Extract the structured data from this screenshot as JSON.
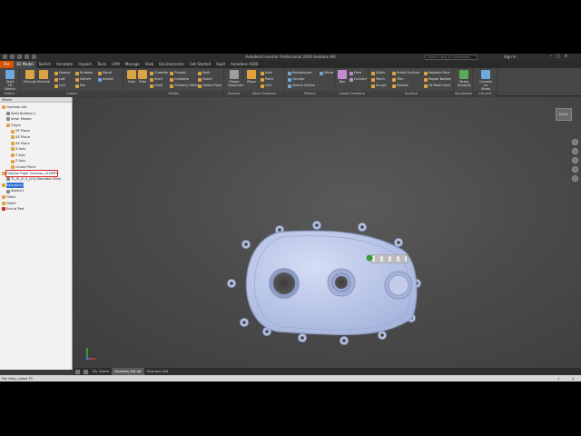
{
  "app_title": "Autodesk Inventor Professional 2019    Gearbox AIA",
  "search_placeholder": "Search Help & Commands...",
  "signin": "Sign In",
  "tabs": [
    "File",
    "3D Model",
    "Sketch",
    "Annotate",
    "Inspect",
    "Tools",
    "CAM",
    "Manage",
    "View",
    "Environments",
    "Get Started",
    "Vault",
    "Autodesk A360"
  ],
  "active_tab": "3D Model",
  "ribbon": {
    "sketch_panel": {
      "label": "Sketch",
      "start_sketch": "Start 2D Sketch"
    },
    "create_panel": {
      "label": "Create",
      "extrude": "Extrude",
      "revolve": "Revolve",
      "col1": [
        "Sweep",
        "Loft",
        "Coil"
      ],
      "col2": [
        "Emboss",
        "Derive",
        "Rib"
      ],
      "col3": [
        "Decal",
        "Import"
      ]
    },
    "modify_panel": {
      "label": "Modify",
      "hole": "Hole",
      "fillet": "Fillet",
      "col1": [
        "Chamfer",
        "Shell",
        "Draft"
      ],
      "col2": [
        "Thread",
        "Combine",
        "Thicken/ Offset"
      ],
      "col3": [
        "Split",
        "Direct",
        "Delete Face"
      ]
    },
    "explore_panel": {
      "label": "Explore",
      "shape_generator": "Shape Generator"
    },
    "work_panel": {
      "label": "Work Features",
      "plane": "Plane",
      "col1": [
        "Axis",
        "Point",
        "UCS"
      ]
    },
    "pattern_panel": {
      "label": "Pattern",
      "col1": [
        "Rectangular",
        "Circular",
        "Sketch Driven"
      ],
      "col2": [
        "Mirror"
      ]
    },
    "freeform_panel": {
      "label": "Create Freeform",
      "box": "Box",
      "col1": [
        "Face",
        "Convert"
      ]
    },
    "surface_panel": {
      "label": "Surface",
      "col1": [
        "Stitch",
        "Patch",
        "Sculpt"
      ],
      "col2": [
        "Ruled Surface",
        "Trim",
        "Extend"
      ],
      "col3": [
        "Replace Face",
        "Repair Bodies",
        "Fit Mesh Face"
      ]
    },
    "simulation_panel": {
      "label": "Simulation",
      "stress": "Stress Analysis"
    },
    "convert_panel": {
      "label": "Convert",
      "sheet_metal": "Convert to Sheet Metal"
    }
  },
  "browser": {
    "header": "Model",
    "nodes": [
      {
        "label": "Gearbox AIA",
        "indent": 0,
        "icon": "#e2a43a",
        "state": ""
      },
      {
        "label": "Solid Bodies(1)",
        "indent": 1,
        "icon": "#888888",
        "state": ""
      },
      {
        "label": "View: Master",
        "indent": 1,
        "icon": "#888888",
        "state": ""
      },
      {
        "label": "Origin",
        "indent": 1,
        "icon": "#e2a43a",
        "state": ""
      },
      {
        "label": "YZ Plane",
        "indent": 2,
        "icon": "#e2a43a",
        "state": ""
      },
      {
        "label": "XZ Plane",
        "indent": 2,
        "icon": "#e2a43a",
        "state": ""
      },
      {
        "label": "XY Plane",
        "indent": 2,
        "icon": "#e2a43a",
        "state": ""
      },
      {
        "label": "X Axis",
        "indent": 2,
        "icon": "#e2a43a",
        "state": ""
      },
      {
        "label": "Y Axis",
        "indent": 2,
        "icon": "#e2a43a",
        "state": ""
      },
      {
        "label": "Z Axis",
        "indent": 2,
        "icon": "#e2a43a",
        "state": ""
      },
      {
        "label": "Center Point",
        "indent": 2,
        "icon": "#e2a43a",
        "state": ""
      },
      {
        "label": "Original Right Gearbox_SLDPRT",
        "indent": 0,
        "icon": "#e2a43a",
        "state": "sel-red"
      },
      {
        "label": "TL_IS_D_S_(15) Diameter Slim)",
        "indent": 1,
        "icon": "#888888",
        "state": ""
      },
      {
        "label": "Extrusion1",
        "indent": 0,
        "icon": "#e2a43a",
        "state": "sel-blue"
      },
      {
        "label": "Sketch1",
        "indent": 1,
        "icon": "#888888",
        "state": ""
      },
      {
        "label": "Fillet1",
        "indent": 0,
        "icon": "#e2a43a",
        "state": ""
      },
      {
        "label": "Fillet2",
        "indent": 0,
        "icon": "#e2a43a",
        "state": ""
      },
      {
        "label": "End of Part",
        "indent": 0,
        "icon": "#cc2222",
        "state": ""
      }
    ]
  },
  "viewcube_label": "BACK",
  "doc_tabs": [
    "My Home",
    "Gearbox AIA.ipt",
    "Gearbox AIA"
  ],
  "active_doc_tab": "Gearbox AIA.ipt",
  "status": {
    "left": "For Help, press F1",
    "right1": "1",
    "right2": "2"
  },
  "colors": {
    "part": "#b9c6e8",
    "part_edge": "#8e9cc4",
    "accent": "#d35400"
  }
}
